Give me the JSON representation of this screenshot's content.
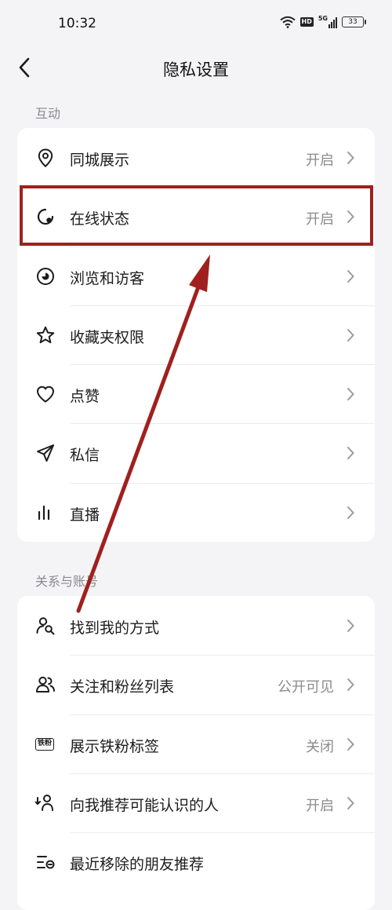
{
  "status_bar": {
    "time": "10:32",
    "network_label": "5G",
    "hd_label": "HD",
    "battery_level": "33"
  },
  "nav": {
    "title": "隐私设置"
  },
  "sections": [
    {
      "label": "互动",
      "items": [
        {
          "icon": "location-pin-icon",
          "label": "同城展示",
          "value": "开启"
        },
        {
          "icon": "online-status-icon",
          "label": "在线状态",
          "value": "开启"
        },
        {
          "icon": "eye-icon",
          "label": "浏览和访客",
          "value": ""
        },
        {
          "icon": "star-icon",
          "label": "收藏夹权限",
          "value": ""
        },
        {
          "icon": "heart-icon",
          "label": "点赞",
          "value": ""
        },
        {
          "icon": "paper-plane-icon",
          "label": "私信",
          "value": ""
        },
        {
          "icon": "live-bars-icon",
          "label": "直播",
          "value": ""
        }
      ]
    },
    {
      "label": "关系与账号",
      "items": [
        {
          "icon": "find-user-icon",
          "label": "找到我的方式",
          "value": ""
        },
        {
          "icon": "users-icon",
          "label": "关注和粉丝列表",
          "value": "公开可见"
        },
        {
          "icon": "fan-badge-icon",
          "icon_text": "铁粉",
          "label": "展示铁粉标签",
          "value": "关闭"
        },
        {
          "icon": "recommend-user-icon",
          "label": "向我推荐可能认识的人",
          "value": "开启"
        },
        {
          "icon": "removed-list-icon",
          "label": "最近移除的朋友推荐",
          "value": ""
        }
      ]
    }
  ],
  "colors": {
    "annotation": "#a0201f",
    "background": "#f4f4f6",
    "card": "#ffffff",
    "muted_text": "#8b8b90"
  }
}
